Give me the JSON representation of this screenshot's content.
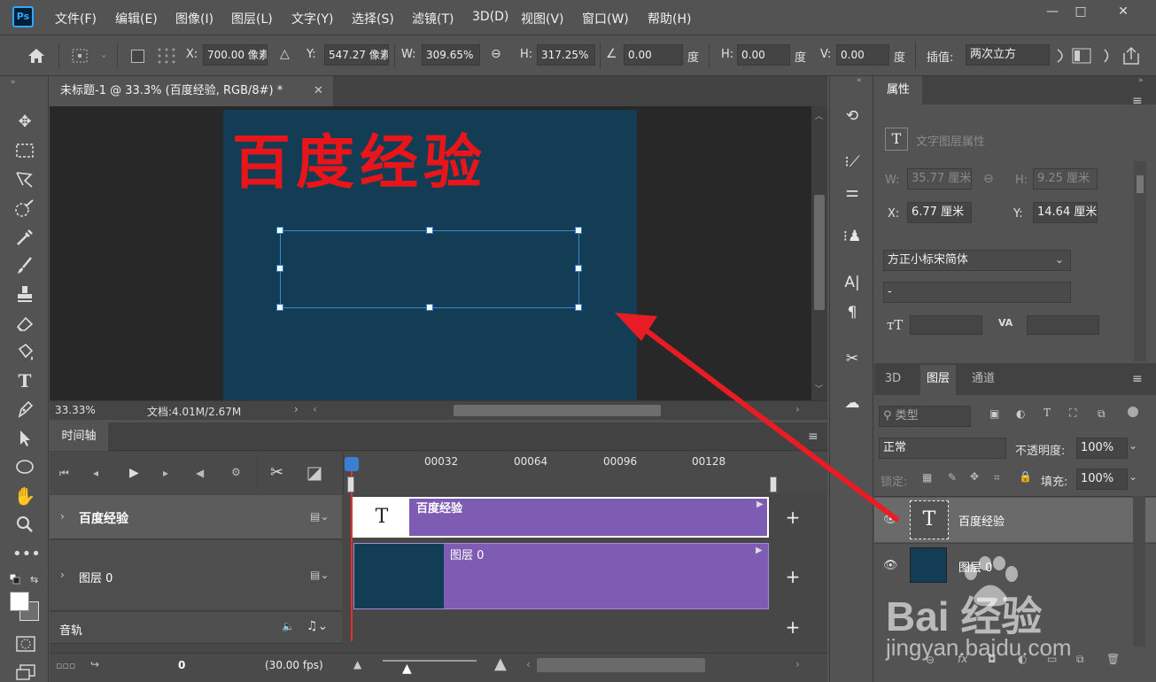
{
  "app": {
    "logo": "Ps"
  },
  "menu": [
    "文件(F)",
    "编辑(E)",
    "图像(I)",
    "图层(L)",
    "文字(Y)",
    "选择(S)",
    "滤镜(T)",
    "3D(D)",
    "视图(V)",
    "窗口(W)",
    "帮助(H)"
  ],
  "window_controls": {
    "minimize": "—",
    "maximize": "□",
    "close": "✕"
  },
  "options": {
    "x_label": "X:",
    "x_value": "700.00 像素",
    "y_label": "Y:",
    "y_value": "547.27 像素",
    "w_label": "W:",
    "w_value": "309.65%",
    "h_label": "H:",
    "h_value": "317.25%",
    "angle_value": "0.00",
    "angle_unit": "度",
    "hskew_label": "H:",
    "hskew_value": "0.00",
    "hskew_unit": "度",
    "vskew_label": "V:",
    "vskew_value": "0.00",
    "vskew_unit": "度",
    "interp_label": "插值:",
    "interp_value": "两次立方"
  },
  "document": {
    "tab_title": "未标题-1 @ 33.3% (百度经验, RGB/8#) *",
    "canvas_text": "百度经验",
    "zoom": "33.33%",
    "doc_info": "文档:4.01M/2.67M"
  },
  "timeline": {
    "title": "时间轴",
    "ruler": [
      "00032",
      "00064",
      "00096",
      "00128"
    ],
    "tracks": [
      {
        "name": "百度经验",
        "clip_label": "百度经验",
        "thumb": "T"
      },
      {
        "name": "图层 0",
        "clip_label": "图层 0"
      }
    ],
    "audio_label": "音轨",
    "frame": "0",
    "fps": "(30.00 fps)"
  },
  "properties": {
    "tab": "属性",
    "header": "文字图层属性",
    "w_label": "W:",
    "w_value": "35.77 厘米",
    "h_label": "H:",
    "h_value": "9.25 厘米",
    "x_label": "X:",
    "x_value": "6.77 厘米",
    "y_label": "Y:",
    "y_value": "14.64 厘米",
    "font_family": "方正小标宋简体",
    "font_style": "-"
  },
  "layers_panel": {
    "tabs": [
      "3D",
      "图层",
      "通道"
    ],
    "filter_label": "类型",
    "blend_mode": "正常",
    "opacity_label": "不透明度:",
    "opacity_value": "100%",
    "lock_label": "锁定:",
    "fill_label": "填充:",
    "fill_value": "100%",
    "layers": [
      {
        "name": "百度经验",
        "thumb": "T"
      },
      {
        "name": "图层 0"
      }
    ]
  },
  "watermark": {
    "text": "jingyan.baidu.com",
    "brand": "Bai 经验"
  },
  "colors": {
    "accent": "#31a8ff",
    "clip": "#7e5cb3",
    "canvas_bg": "#133d55",
    "text_red": "#e8151a",
    "arrow": "#e81c24"
  }
}
